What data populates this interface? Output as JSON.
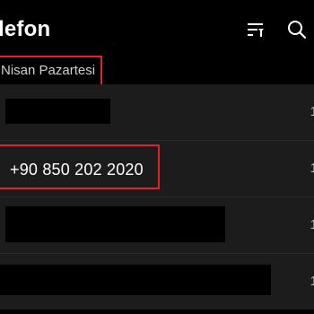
{
  "header": {
    "title": "lefon",
    "sort_icon": "sort-filter-icon",
    "search_icon": "search-icon"
  },
  "section": {
    "date_label": "Nisan Pazartesi"
  },
  "calls": [
    {
      "number": "",
      "time": "1",
      "redacted": true
    },
    {
      "number": "+90 850 202 2020",
      "time": "1",
      "redacted": false
    },
    {
      "number": "",
      "time": "1",
      "redacted": true
    },
    {
      "number": "",
      "time": "1",
      "redacted": true
    }
  ],
  "colors": {
    "background": "#000000",
    "row_background": "#1c1c1c",
    "highlight_border": "#e3202b",
    "text_primary": "#ffffff",
    "text_secondary": "#bdbdbd"
  }
}
